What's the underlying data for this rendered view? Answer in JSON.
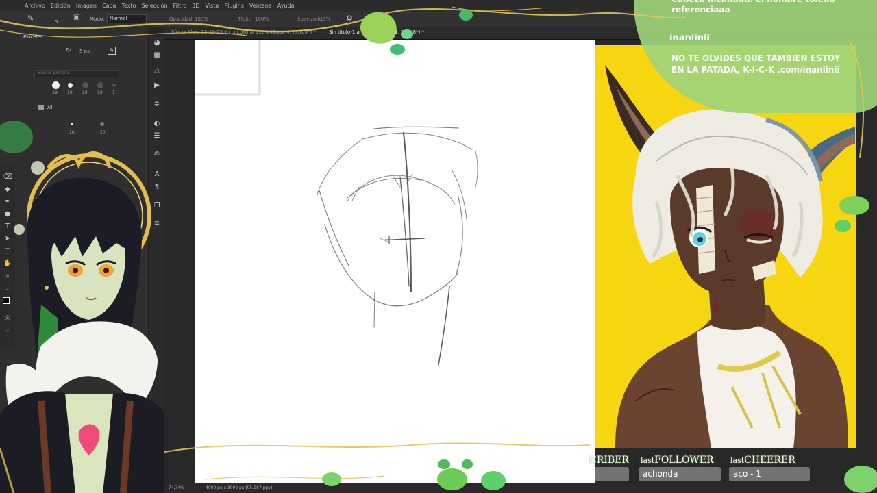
{
  "app": {
    "menu": [
      "Archivo",
      "Edición",
      "Imagen",
      "Capa",
      "Texto",
      "Selección",
      "Filtro",
      "3D",
      "Vista",
      "Plugins",
      "Ventana",
      "Ayuda"
    ],
    "options": {
      "mode_label": "Modo:",
      "mode_value": "Normal",
      "opacity_label": "Opacidad:",
      "opacity_value": "100%",
      "flow_label": "Flujo:",
      "flow_value": "100%",
      "smoothing_label": "Suavizado:",
      "smoothing_value": "15%",
      "brush_size": "5"
    },
    "tabs": [
      {
        "label": "Sforza Skeb 13-19-25 Yo Lin.psd al 150% (Capa 4, RGB/8*) *",
        "active": false
      },
      {
        "label": "Sin título-1 al 74,7% (Capa 1, RGB/8*) *",
        "active": true
      }
    ],
    "brushes_panel": {
      "title": "Pinceles",
      "size_value": "5 px",
      "search_placeholder": "Buscar pinceles",
      "preset_sizes": [
        "39",
        "10",
        "20",
        "10",
        "1"
      ],
      "folder_label": "All",
      "sub_sizes": [
        "10",
        "20"
      ],
      "brush_count": "100"
    },
    "status": {
      "zoom": "74,74%",
      "doc_size": "4000 px x 3000 px (95,987 ppp)"
    }
  },
  "chat": {
    "previous_message": "Cabeza inclinada. el nombre toledo referenciaaa",
    "username": "inaniinii",
    "message": "NO TE OLVIDES QUE TAMBIEN ESTOY EN LA PATADA, K-I-C-K .com/inaniinii"
  },
  "stats": [
    {
      "label": "SUBSCRIBER",
      "prefix": "",
      "value": "nis"
    },
    {
      "label": "FOLLOWER",
      "prefix": "last",
      "value": "achonda"
    },
    {
      "label": "CHEERER",
      "prefix": "last",
      "value": "aco - 1"
    }
  ],
  "colors": {
    "reference_bg": "#f6d610",
    "chat_bg": "#9dd478",
    "gold": "#e8c453",
    "panel": "#2f2f2f"
  }
}
